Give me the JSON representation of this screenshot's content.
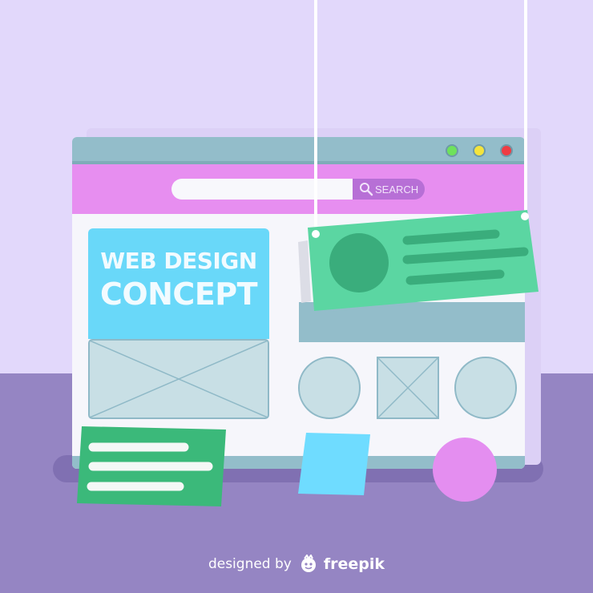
{
  "colors": {
    "wall": "#e2d8fb",
    "floor": "#9585c3",
    "window_frame": "#93bdca",
    "nav_bar": "#e78ef0",
    "hero": "#69d8f9",
    "card_green": "#5bd6a2",
    "card_green_dark": "#3aad7c",
    "note_green": "#3bb97a",
    "note_blue": "#6fdcff",
    "ball_pink": "#e48ef0"
  },
  "window": {
    "traffic_lights": [
      {
        "name": "green-light",
        "color": "#6ee25c"
      },
      {
        "name": "yellow-light",
        "color": "#f4e43c"
      },
      {
        "name": "red-light",
        "color": "#ee3d44"
      }
    ],
    "search": {
      "value": "",
      "placeholder": "",
      "button_label": "SEARCH",
      "icon": "search-icon"
    }
  },
  "hero": {
    "line1": "WEB DESIGN",
    "line2": "CONCEPT"
  },
  "footer": {
    "prefix": "designed by",
    "brand": "freepik",
    "icon": "freepik-logo-icon"
  }
}
